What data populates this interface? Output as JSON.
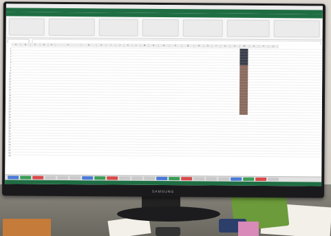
{
  "monitor": {
    "brand": "SAMSUNG"
  },
  "excel": {
    "columns": [
      "A",
      "B",
      "C",
      "D",
      "E",
      "F",
      "G",
      "H",
      "I",
      "J",
      "K",
      "L",
      "M",
      "N",
      "O",
      "P",
      "Q",
      "R",
      "S",
      "T",
      "U",
      "V",
      "W",
      "X",
      "Y",
      "Z"
    ],
    "row_numbers": [
      "1",
      "2",
      "3",
      "4",
      "5",
      "6",
      "7",
      "8",
      "9",
      "10",
      "11",
      "12",
      "13",
      "14",
      "15",
      "16",
      "17",
      "18",
      "19",
      "20",
      "21",
      "22",
      "23",
      "24",
      "25",
      "26",
      "27",
      "28",
      "29",
      "30",
      "31",
      "32",
      "33",
      "34",
      "35",
      "36",
      "37",
      "38",
      "39",
      "40"
    ],
    "sheet_tab_count": 22
  },
  "colors": {
    "excel_green": "#1f6e43",
    "header_gray": "#ececec",
    "filled_cell_brown": "#8b6b5e",
    "filled_cell_dark": "#3a3f4b"
  }
}
